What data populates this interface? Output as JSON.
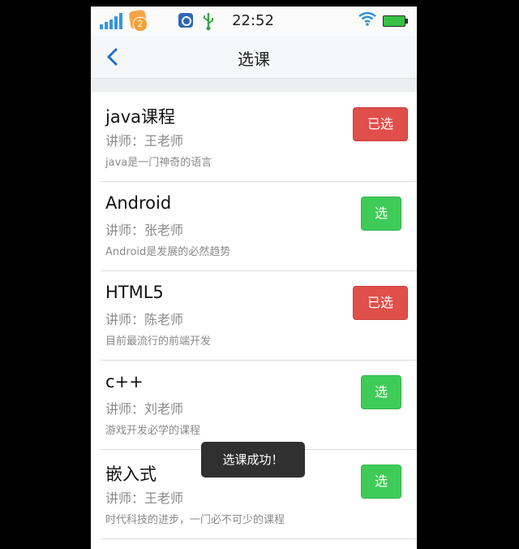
{
  "status_bar": {
    "time": "22:52",
    "notification_count": "2"
  },
  "nav": {
    "title": "选课",
    "back_icon": "chevron-left-icon"
  },
  "courses": [
    {
      "name": "java课程",
      "teacher": "讲师：王老师",
      "description": "java是一门神奇的语言",
      "button": "已选",
      "selected": true
    },
    {
      "name": "Android",
      "teacher": "讲师：张老师",
      "description": "Android是发展的必然趋势",
      "button": "选",
      "selected": false
    },
    {
      "name": "HTML5",
      "teacher": "讲师：陈老师",
      "description": "目前最流行的前端开发",
      "button": "已选",
      "selected": true
    },
    {
      "name": "c++",
      "teacher": "讲师：刘老师",
      "description": "游戏开发必学的课程",
      "button": "选",
      "selected": false
    },
    {
      "name": "嵌入式",
      "teacher": "讲师：王老师",
      "description": "时代科技的进步，一门必不可少的课程",
      "button": "选",
      "selected": false
    }
  ],
  "toast": {
    "message": "选课成功！"
  },
  "colors": {
    "selected_button": "#e04f4a",
    "select_button": "#3fcb58",
    "nav_accent": "#1f6fd0"
  }
}
